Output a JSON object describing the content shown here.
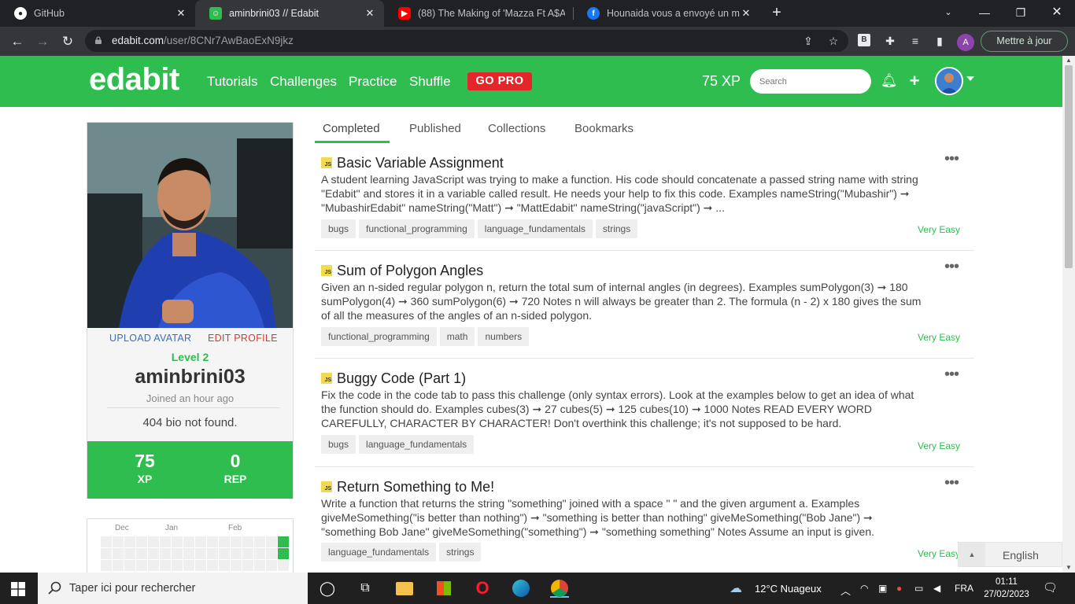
{
  "browser": {
    "tabs": [
      {
        "title": "GitHub",
        "icon": "github-icon"
      },
      {
        "title": "aminbrini03 // Edabit",
        "icon": "edabit-icon"
      },
      {
        "title": "(88) The Making of 'Mazza Ft A$A",
        "icon": "youtube-icon"
      },
      {
        "title": "Hounaida vous a envoyé un mes",
        "icon": "facebook-icon"
      }
    ],
    "url_domain": "edabit.com",
    "url_path": "/user/8CNr7AwBaoExN9jkz",
    "profile_initial": "A",
    "update_label": "Mettre à jour"
  },
  "navbar": {
    "logo": "edabit",
    "links": [
      "Tutorials",
      "Challenges",
      "Practice",
      "Shuffle"
    ],
    "gopro": "GO PRO",
    "xp": "75 XP",
    "search_placeholder": "Search",
    "color": "#2ebd4e"
  },
  "profile": {
    "upload_avatar": "UPLOAD AVATAR",
    "edit_profile": "EDIT PROFILE",
    "level": "Level 2",
    "username": "aminbrini03",
    "joined": "Joined an hour ago",
    "bio": "404 bio not found.",
    "xp_value": "75",
    "xp_label": "XP",
    "rep_value": "0",
    "rep_label": "REP"
  },
  "calendar": {
    "months": [
      "Dec",
      "Jan",
      "Feb"
    ]
  },
  "tabs": [
    "Completed",
    "Published",
    "Collections",
    "Bookmarks"
  ],
  "challenges": [
    {
      "badge": "JS",
      "title": "Basic Variable Assignment",
      "description": "A student learning JavaScript was trying to make a function. His code should concatenate a passed string name with string \"Edabit\" and stores it in a variable called result. He needs your help to fix this code. Examples nameString(\"Mubashir\") ➞ \"MubashirEdabit\" nameString(\"Matt\") ➞ \"MattEdabit\" nameString(\"javaScript\") ➞ ...",
      "tags": [
        "bugs",
        "functional_programming",
        "language_fundamentals",
        "strings"
      ],
      "difficulty": "Very Easy"
    },
    {
      "badge": "JS",
      "title": "Sum of Polygon Angles",
      "description": "Given an n-sided regular polygon n, return the total sum of internal angles (in degrees). Examples sumPolygon(3) ➞ 180 sumPolygon(4) ➞ 360 sumPolygon(6) ➞ 720 Notes n will always be greater than 2. The formula (n - 2) x 180 gives the sum of all the measures of the angles of an n-sided polygon.",
      "tags": [
        "functional_programming",
        "math",
        "numbers"
      ],
      "difficulty": "Very Easy"
    },
    {
      "badge": "JS",
      "title": "Buggy Code (Part 1)",
      "description": "Fix the code in the code tab to pass this challenge (only syntax errors). Look at the examples below to get an idea of what the function should do. Examples cubes(3) ➞ 27 cubes(5) ➞ 125 cubes(10) ➞ 1000 Notes READ EVERY WORD CAREFULLY, CHARACTER BY CHARACTER! Don't overthink this challenge; it's not supposed to be hard.",
      "tags": [
        "bugs",
        "language_fundamentals"
      ],
      "difficulty": "Very Easy"
    },
    {
      "badge": "JS",
      "title": "Return Something to Me!",
      "description": "Write a function that returns the string \"something\" joined with a space \" \" and the given argument a. Examples giveMeSomething(\"is better than nothing\") ➞ \"something is better than nothing\" giveMeSomething(\"Bob Jane\") ➞ \"something Bob Jane\" giveMeSomething(\"something\") ➞ \"something something\" Notes Assume an input is given.",
      "tags": [
        "language_fundamentals",
        "strings"
      ],
      "difficulty": "Very Easy"
    }
  ],
  "language_widget": "English",
  "taskbar": {
    "search_text": "Taper ici pour rechercher",
    "weather": "12°C  Nuageux",
    "lang": "FRA",
    "time": "01:11",
    "date": "27/02/2023"
  }
}
